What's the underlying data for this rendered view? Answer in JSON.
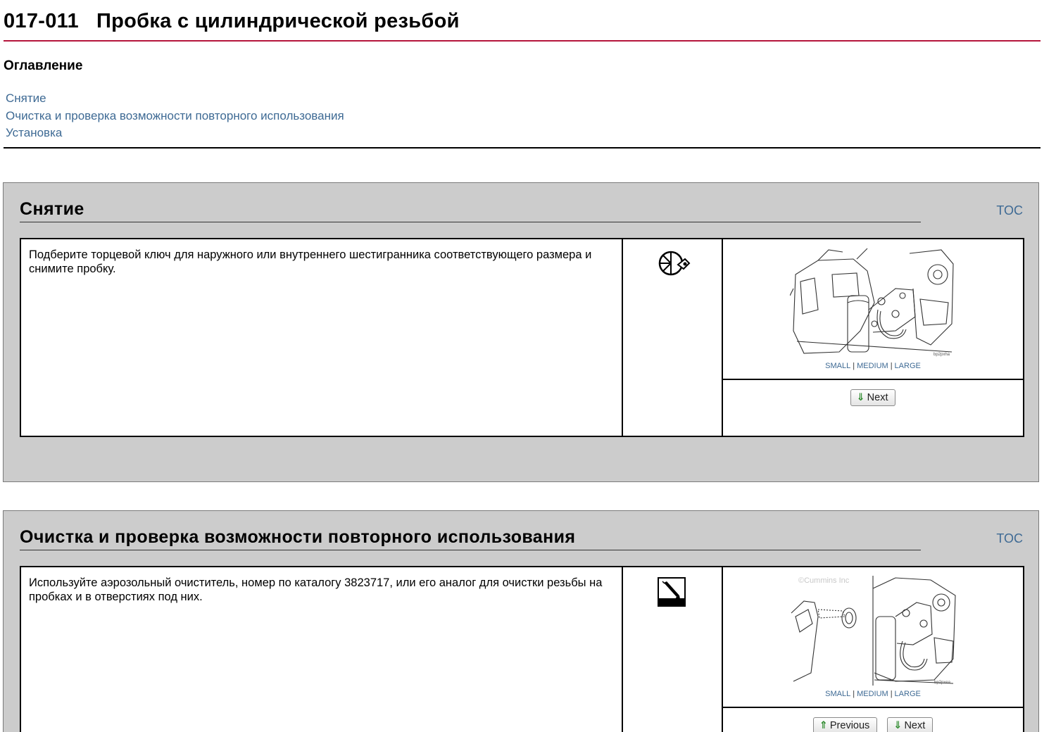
{
  "header": {
    "title": "017-011   Пробка с цилиндрической резьбой"
  },
  "toc": {
    "heading": "Оглавление",
    "links": [
      "Снятие",
      "Очистка и проверка возможности повторного использования",
      "Установка"
    ]
  },
  "sections": [
    {
      "title": "Снятие",
      "toc_link": "TOC",
      "step_text": "Подберите торцевой ключ для наружного или внутреннего шестигранника соответствующего размера и снимите пробку.",
      "icon": "socket-wrench-icon",
      "figure_label": "bp2pxha",
      "size_links": [
        "SMALL",
        "MEDIUM",
        "LARGE"
      ],
      "next_label": "Next"
    },
    {
      "title": "Очистка и проверка возможности повторного использования",
      "toc_link": "TOC",
      "step_text": "Используйте аэрозольный очиститель, номер по каталогу 3823717, или его аналог для очистки резьбы на пробках и в отверстиях под них.",
      "icon": "aerosol-spray-icon",
      "figure_label": "bp2pxea",
      "figure_watermark": "©Cummins Inc",
      "size_links": [
        "SMALL",
        "MEDIUM",
        "LARGE"
      ],
      "previous_label": "Previous",
      "next_label": "Next"
    }
  ]
}
